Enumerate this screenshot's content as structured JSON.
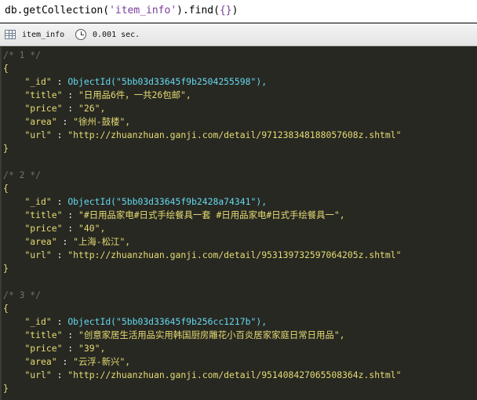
{
  "query": {
    "prefix": "db.getCollection(",
    "collection_literal": "'item_info'",
    "middle": ").find(",
    "filter": "{}",
    "suffix": ")"
  },
  "status": {
    "collection_icon": "table-icon",
    "collection": "item_info",
    "time_icon": "clock-icon",
    "time": "0.001 sec."
  },
  "records": [
    {
      "comment": "/* 1 */",
      "open": "{",
      "close": "}",
      "fields": [
        {
          "key": "\"_id\"",
          "value": "ObjectId(\"5bb03d33645f9b2504255598\"),",
          "kind": "oid"
        },
        {
          "key": "\"title\"",
          "value": "\"日用品6件，一共26包邮\",",
          "kind": "str"
        },
        {
          "key": "\"price\"",
          "value": "\"26\",",
          "kind": "str"
        },
        {
          "key": "\"area\"",
          "value": "\"徐州-鼓楼\",",
          "kind": "str"
        },
        {
          "key": "\"url\"",
          "value": "\"http://zhuanzhuan.ganji.com/detail/971238348188057608z.shtml\"",
          "kind": "str"
        }
      ]
    },
    {
      "comment": "/* 2 */",
      "open": "{",
      "close": "}",
      "fields": [
        {
          "key": "\"_id\"",
          "value": "ObjectId(\"5bb03d33645f9b2428a74341\"),",
          "kind": "oid"
        },
        {
          "key": "\"title\"",
          "value": "\"#日用品家电#日式手绘餐具一套 #日用品家电#日式手绘餐具一\",",
          "kind": "str"
        },
        {
          "key": "\"price\"",
          "value": "\"40\",",
          "kind": "str"
        },
        {
          "key": "\"area\"",
          "value": "\"上海-松江\",",
          "kind": "str"
        },
        {
          "key": "\"url\"",
          "value": "\"http://zhuanzhuan.ganji.com/detail/953139732597064205z.shtml\"",
          "kind": "str"
        }
      ]
    },
    {
      "comment": "/* 3 */",
      "open": "{",
      "close": "}",
      "fields": [
        {
          "key": "\"_id\"",
          "value": "ObjectId(\"5bb03d33645f9b256cc1217b\"),",
          "kind": "oid"
        },
        {
          "key": "\"title\"",
          "value": "\"创意家居生活用品实用韩国厨房雕花小百炎居家家庭日常日用品\",",
          "kind": "str"
        },
        {
          "key": "\"price\"",
          "value": "\"39\",",
          "kind": "str"
        },
        {
          "key": "\"area\"",
          "value": "\"云浮-新兴\",",
          "kind": "str"
        },
        {
          "key": "\"url\"",
          "value": "\"http://zhuanzhuan.ganji.com/detail/951408427065508364z.shtml\"",
          "kind": "str"
        }
      ]
    }
  ],
  "colors": {
    "background": "#272822",
    "comment": "#75715e",
    "string": "#e6db74",
    "text": "#f8f8f2",
    "objectid": "#66d9ef"
  }
}
